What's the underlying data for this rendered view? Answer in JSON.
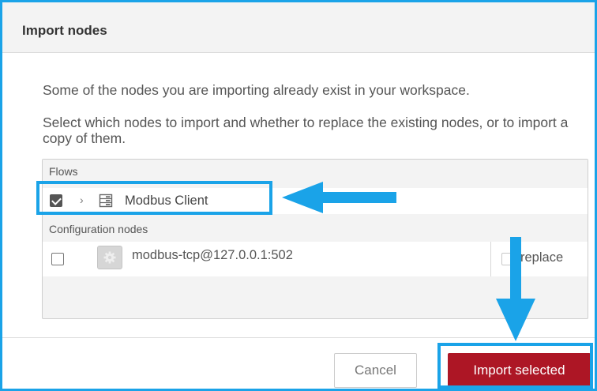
{
  "dialog": {
    "title": "Import nodes",
    "message_line1": "Some of the nodes you are importing already exist in your workspace.",
    "message_line2": "Select which nodes to import and whether to replace the existing nodes, or to import a copy of them."
  },
  "nodelist": {
    "flows_header": "Flows",
    "flow_item": {
      "label": "Modbus Client",
      "checked": true,
      "icon": "flow-icon",
      "chevron": "›"
    },
    "config_header": "Configuration nodes",
    "config_item": {
      "label": "modbus-tcp@127.0.0.1:502",
      "checked": false,
      "icon": "gear-icon",
      "replace_label": "replace",
      "replace_checked": false
    }
  },
  "buttons": {
    "cancel": "Cancel",
    "import_selected": "Import selected"
  },
  "colors": {
    "annotation": "#1aa3e8",
    "import_button": "#ad1625"
  }
}
